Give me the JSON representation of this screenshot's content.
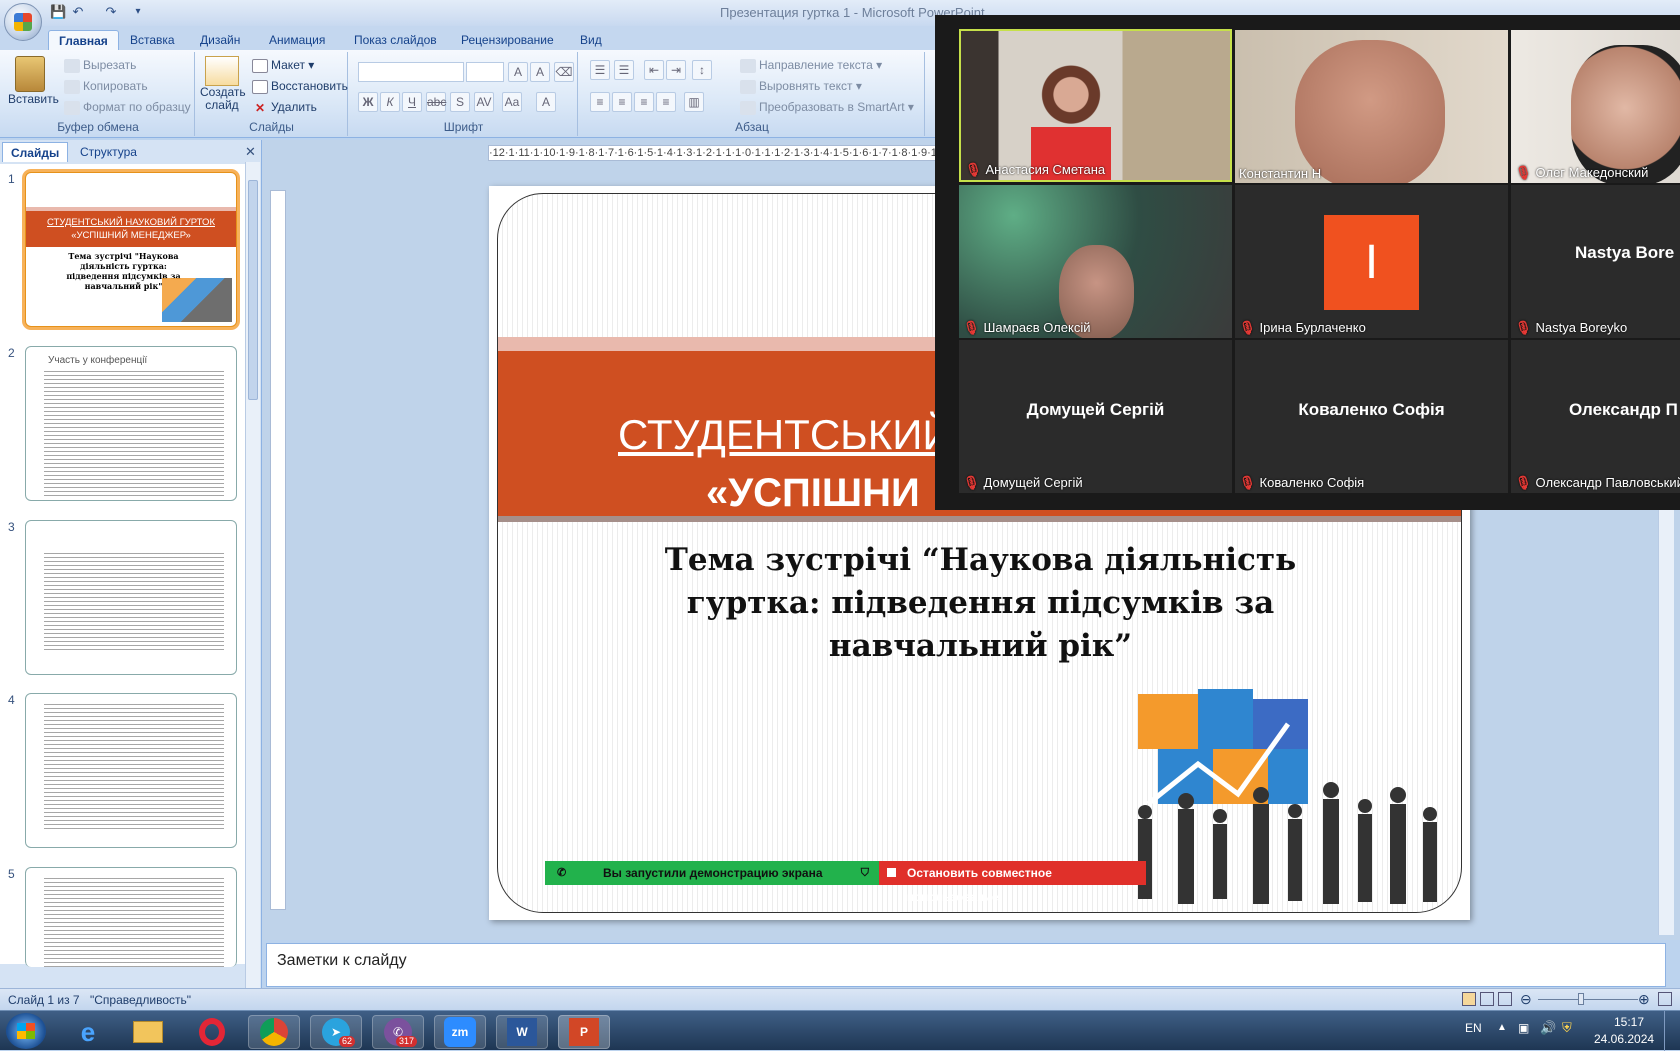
{
  "window": {
    "title": "Презентация гуртка 1 - Microsoft PowerPoint"
  },
  "tabs": [
    "Главная",
    "Вставка",
    "Дизайн",
    "Анимация",
    "Показ слайдов",
    "Рецензирование",
    "Вид"
  ],
  "ribbon": {
    "clipboard": {
      "paste": "Вставить",
      "cut": "Вырезать",
      "copy": "Копировать",
      "format_painter": "Формат по образцу",
      "label": "Буфер обмена"
    },
    "slides": {
      "new_slide": "Создать слайд",
      "layout": "Макет",
      "reset": "Восстановить",
      "delete": "Удалить",
      "label": "Слайды"
    },
    "font": {
      "label": "Шрифт"
    },
    "paragraph": {
      "text_direction": "Направление текста",
      "align_text": "Выровнять текст",
      "smartart": "Преобразовать в SmartArt",
      "label": "Абзац"
    }
  },
  "left_pane": {
    "tab_slides": "Слайды",
    "tab_outline": "Структура",
    "thumb1": {
      "num": "1",
      "title1": "СТУДЕНТСЬКИЙ НАУКОВИЙ ГУРТОК",
      "title2": "«УСПІШНИЙ МЕНЕДЖЕР»",
      "subtitle": "Тема зустрічі \"Наукова діяльність гуртка: підведення підсумків за навчальний рік\""
    },
    "thumb2": {
      "num": "2",
      "title": "Участь у конференції"
    },
    "thumb3": {
      "num": "3"
    },
    "thumb4": {
      "num": "4"
    },
    "thumb5": {
      "num": "5"
    }
  },
  "ruler": {
    "text": "·12·1·11·1·10·1·9·1·8·1·7·1·6·1·5·1·4·1·3·1·2·1·1·1·0·1·1·1·2·1·3·1·4·1·5·1·6·1·7·1·8·1·9·1·10·1·11·1·12·"
  },
  "slide": {
    "title_line1": "СТУДЕНТСЬКИЙ",
    "title_line2": "«УСПІШНИ",
    "subtitle": "Тема зустрічі “Наукова діяльність гуртка: підведення підсумків за навчальний рік”"
  },
  "notes": {
    "placeholder": "Заметки к слайду"
  },
  "status": {
    "slide_info": "Слайд 1 из 7",
    "theme": "\"Справедливость\""
  },
  "zoom": {
    "participants": [
      {
        "name": "Анастасия Сметана",
        "video": true
      },
      {
        "name": "Константин Н",
        "video": true
      },
      {
        "name": "Олег Македонский",
        "video": true
      },
      {
        "name": "Шамраєв Олексій",
        "video": true
      },
      {
        "name": "Ірина Бурлаченко",
        "avatar_letter": "I"
      },
      {
        "name": "Nastya Boreyko",
        "display": "Nastya Bore"
      },
      {
        "name": "Домущей Сергій",
        "display": "Домущей Сергій"
      },
      {
        "name": "Коваленко Софія",
        "display": "Коваленко Софія"
      },
      {
        "name": "Олександр Павловський",
        "display": "Олександр П"
      }
    ],
    "share_status": "Вы запустили демонстрацию экрана",
    "stop_share": "Остановить совместное использование"
  },
  "taskbar": {
    "lang": "EN",
    "time": "15:17",
    "date": "24.06.2024",
    "telegram_badge": "62",
    "viber_badge": "317"
  },
  "colors": {
    "slide_orange": "#cf4f21",
    "zoom_green": "#22b24c",
    "zoom_red": "#e0302a",
    "avatar_orange": "#f0511f"
  }
}
